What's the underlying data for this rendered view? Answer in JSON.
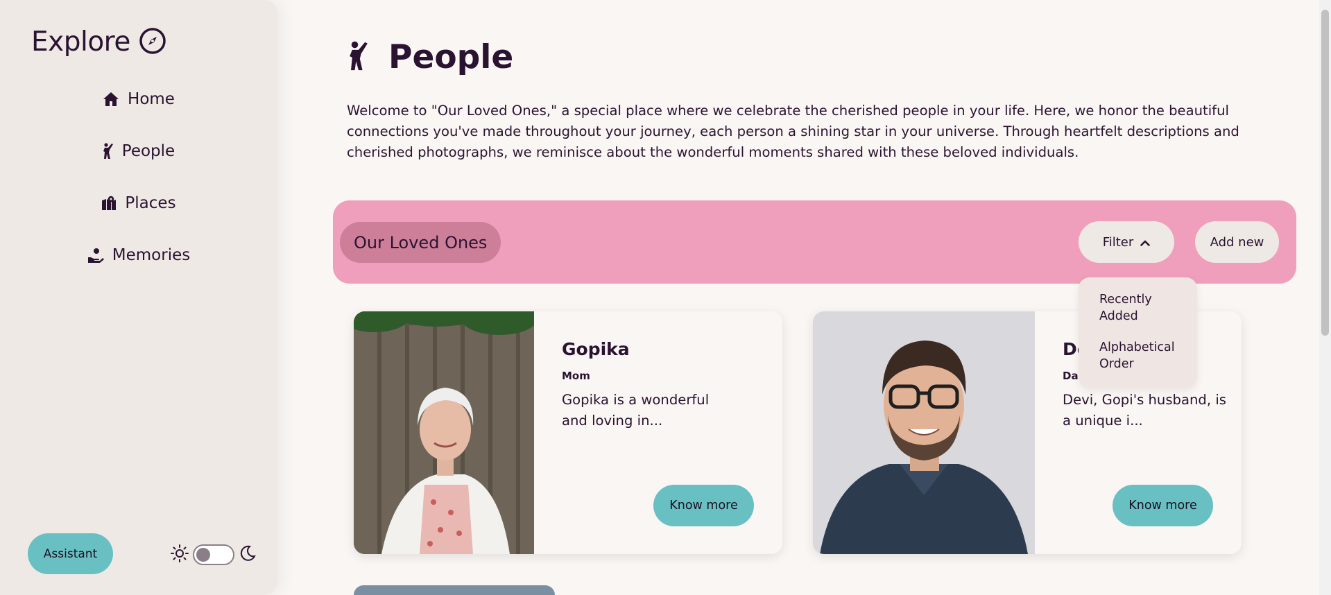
{
  "sidebar": {
    "brand": "Explore",
    "nav": [
      {
        "label": "Home",
        "icon": "home-icon"
      },
      {
        "label": "People",
        "icon": "person-waving-icon"
      },
      {
        "label": "Places",
        "icon": "map-location-icon"
      },
      {
        "label": "Memories",
        "icon": "hand-holding-heart-icon"
      }
    ],
    "assistant_label": "Assistant",
    "theme": {
      "light_icon": "sun-icon",
      "dark_icon": "moon-icon",
      "dark_mode": false
    }
  },
  "page": {
    "title": "People",
    "title_icon": "person-waving-icon",
    "intro": "Welcome to \"Our Loved Ones,\" a special place where we celebrate the cherished people in your life. Here, we honor the beautiful connections you've made throughout your journey, each person a shining star in your universe. Through heartfelt descriptions and cherished photographs, we reminisce about the wonderful moments shared with these beloved individuals."
  },
  "banner": {
    "title": "Our Loved Ones",
    "filter_label": "Filter",
    "add_label": "Add new",
    "filter_options": [
      "Recently Added",
      "Alphabetical Order"
    ]
  },
  "cards": [
    {
      "name": "Gopika",
      "role": "Mom",
      "description": "Gopika is a wonderful and loving in...",
      "button": "Know more"
    },
    {
      "name": "De",
      "role": "Dad",
      "description": "Devi, Gopi's husband, is a unique i...",
      "button": "Know more"
    }
  ],
  "colors": {
    "accent_teal": "#68c0c3",
    "banner_pink": "#ef9fbb",
    "banner_title_pink": "#cd7f9a",
    "text_dark": "#2a1330",
    "sidebar_bg": "#efe9e6",
    "page_bg": "#faf6f3"
  }
}
